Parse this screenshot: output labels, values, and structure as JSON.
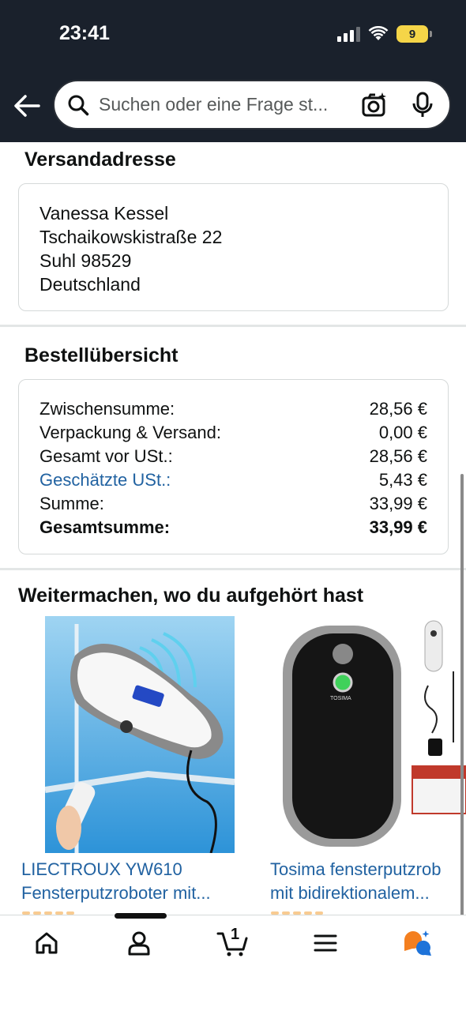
{
  "status_bar": {
    "time": "23:41",
    "battery": "9"
  },
  "search": {
    "placeholder": "Suchen oder eine Frage st..."
  },
  "shipping": {
    "title": "Versandadresse",
    "lines": [
      "Vanessa Kessel",
      "Tschaikowskistraße 22",
      "Suhl 98529",
      "Deutschland"
    ]
  },
  "order_summary": {
    "title": "Bestellübersicht",
    "rows": [
      {
        "label": "Zwischensumme:",
        "value": "28,56 €"
      },
      {
        "label": "Verpackung & Versand:",
        "value": "0,00 €"
      },
      {
        "label": "Gesamt vor USt.:",
        "value": "28,56 €"
      },
      {
        "label": "Geschätzte USt.:",
        "value": "5,43 €"
      },
      {
        "label": "Summe:",
        "value": "33,99 €"
      },
      {
        "label": "Gesamtsumme:",
        "value": "33,99 €"
      }
    ]
  },
  "recommendations": {
    "title": "Weitermachen, wo du aufgehört hast",
    "items": [
      {
        "line1": "LIECTROUX YW610",
        "line2": "Fensterputzroboter mit..."
      },
      {
        "line1": "Tosima fensterputzrob",
        "line2": "mit bidirektionalem...",
        "brand_text": "TOSIMA"
      }
    ]
  },
  "bottom_nav": {
    "cart_count": "1"
  },
  "colors": {
    "header_bg": "#1a212c",
    "link": "#2162a1",
    "battery": "#f5d548"
  }
}
